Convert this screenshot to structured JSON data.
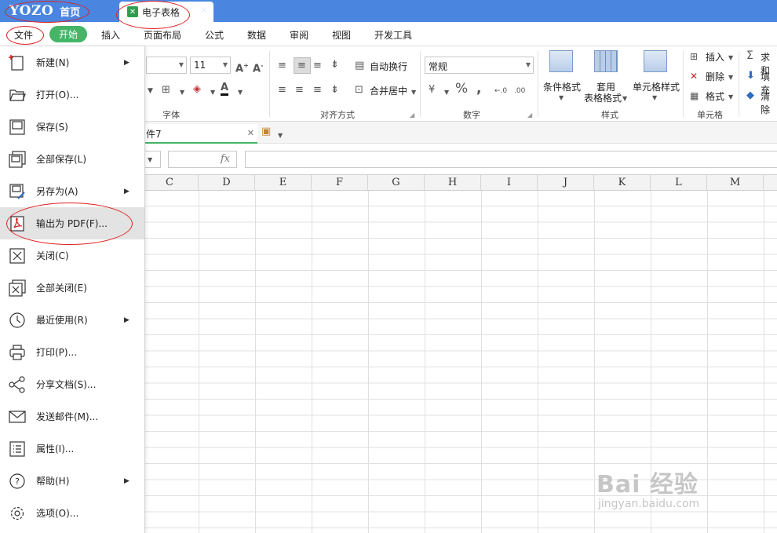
{
  "title_bar": {
    "brand": "YOZO",
    "home_label": "首页",
    "document_tab": "电子表格"
  },
  "menu_bar": {
    "file": "文件",
    "start": "开始",
    "items": [
      "插入",
      "页面布局",
      "公式",
      "数据",
      "审阅",
      "视图",
      "开发工具"
    ]
  },
  "ribbon": {
    "font_size": "11",
    "groups": {
      "font": "字体",
      "alignment": "对齐方式",
      "number": "数字",
      "style": "样式",
      "cells": "单元格"
    },
    "buttons": {
      "wrap_text": "自动换行",
      "merge_center": "合并居中",
      "number_format": "常规",
      "conditional_format": "条件格式",
      "table_format_line1": "套用",
      "table_format_line2": "表格格式",
      "cell_style": "单元格样式",
      "insert": "插入",
      "delete": "删除",
      "format": "格式",
      "sum": "求和",
      "fill": "填充",
      "clear": "清除"
    }
  },
  "doc_tabs": {
    "sheet_tab": "件7"
  },
  "formula_bar": {
    "fx": "fx"
  },
  "columns": [
    "C",
    "D",
    "E",
    "F",
    "G",
    "H",
    "I",
    "J",
    "K",
    "L",
    "M"
  ],
  "file_menu": {
    "items": [
      {
        "label": "新建(N)",
        "submenu": true
      },
      {
        "label": "打开(O)...",
        "submenu": false
      },
      {
        "label": "保存(S)",
        "submenu": false
      },
      {
        "label": "全部保存(L)",
        "submenu": false
      },
      {
        "label": "另存为(A)",
        "submenu": true
      },
      {
        "label": "输出为 PDF(F)...",
        "submenu": false
      },
      {
        "label": "关闭(C)",
        "submenu": false
      },
      {
        "label": "全部关闭(E)",
        "submenu": false
      },
      {
        "label": "最近使用(R)",
        "submenu": true
      },
      {
        "label": "打印(P)...",
        "submenu": false
      },
      {
        "label": "分享文档(S)...",
        "submenu": false
      },
      {
        "label": "发送邮件(M)...",
        "submenu": false
      },
      {
        "label": "属性(I)...",
        "submenu": false
      },
      {
        "label": "帮助(H)",
        "submenu": true
      },
      {
        "label": "选项(O)...",
        "submenu": false
      }
    ]
  },
  "watermark": {
    "text": "Bai 经验",
    "sub": "jingyan.baidu.com"
  },
  "colors": {
    "titlebar": "#4a86e0",
    "accent_green": "#45b466",
    "annotation_red": "#e02020"
  }
}
